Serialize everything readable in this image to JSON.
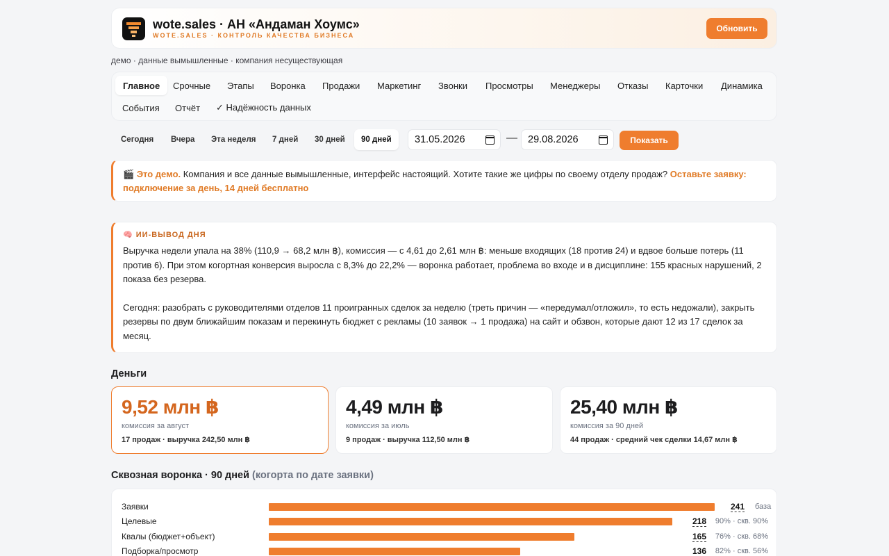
{
  "header": {
    "title": "wote.sales · АН «Андаман Хоумс»",
    "subtitle": "WOTE.SALES · КОНТРОЛЬ КАЧЕСТВА БИЗНЕСА",
    "refresh_label": "Обновить"
  },
  "demo_line": "демо · данные вымышленные · компания несуществующая",
  "tabs": [
    "Главное",
    "Срочные",
    "Этапы",
    "Воронка",
    "Продажи",
    "Маркетинг",
    "Звонки",
    "Просмотры",
    "Менеджеры",
    "Отказы",
    "Карточки",
    "Динамика",
    "События",
    "Отчёт",
    "✓ Надёжность данных"
  ],
  "active_tab": "Главное",
  "period": {
    "buttons": [
      "Сегодня",
      "Вчера",
      "Эта неделя",
      "7 дней",
      "30 дней",
      "90 дней"
    ],
    "active": "90 дней",
    "date_from": "31.05.2026",
    "date_to": "29.08.2026",
    "dash": "—",
    "show_label": "Показать"
  },
  "notice": {
    "emoji": "🎬",
    "accent": "Это демо.",
    "text": " Компания и все данные вымышленные, интерфейс настоящий. Хотите такие же цифры по своему отделу продаж? ",
    "link": "Оставьте заявку: подключение за день, 14 дней бесплатно"
  },
  "ai": {
    "emoji": "🧠",
    "title": "ИИ-ВЫВОД ДНЯ",
    "p1": "Выручка недели упала на 38% (110,9 → 68,2 млн ฿), комиссия — с 4,61 до 2,61 млн ฿: меньше входящих (18 против 24) и вдвое больше потерь (11 против 6). При этом когортная конверсия выросла с 8,3% до 22,2% — воронка работает, проблема во входе и в дисциплине: 155 красных нарушений, 2 показа без резерва.",
    "p2": "Сегодня: разобрать с руководителями отделов 11 проигранных сделок за неделю (треть причин — «передумал/отложил», то есть недожали), закрыть резервы по двум ближайшим показам и перекинуть бюджет с рекламы (10 заявок → 1 продажа) на сайт и обзвон, которые дают 12 из 17 сделок за месяц."
  },
  "money": {
    "heading": "Деньги",
    "cards": [
      {
        "value": "9,52 млн ฿",
        "label": "комиссия за август",
        "detail": "17 продаж · выручка 242,50 млн ฿"
      },
      {
        "value": "4,49 млн ฿",
        "label": "комиссия за июль",
        "detail": "9 продаж · выручка 112,50 млн ฿"
      },
      {
        "value": "25,40 млн ฿",
        "label": "комиссия за 90 дней",
        "detail": "44 продаж · средний чек сделки 14,67 млн ฿"
      }
    ]
  },
  "funnel": {
    "heading": "Сквозная воронка · 90 дней",
    "heading_muted": "(когорта по дате заявки)",
    "base_label": "база",
    "rows": [
      {
        "label": "Заявки",
        "value": 241,
        "pct": ""
      },
      {
        "label": "Целевые",
        "value": 218,
        "pct": "90% · скв. 90%"
      },
      {
        "label": "Квалы (бюджет+объект)",
        "value": 165,
        "pct": "76% · скв. 68%"
      },
      {
        "label": "Подборка/просмотр",
        "value": 136,
        "pct": "82% · скв. 56%"
      }
    ]
  },
  "colors": {
    "accent": "#ef7d2e",
    "accent_dark": "#d4661e"
  }
}
